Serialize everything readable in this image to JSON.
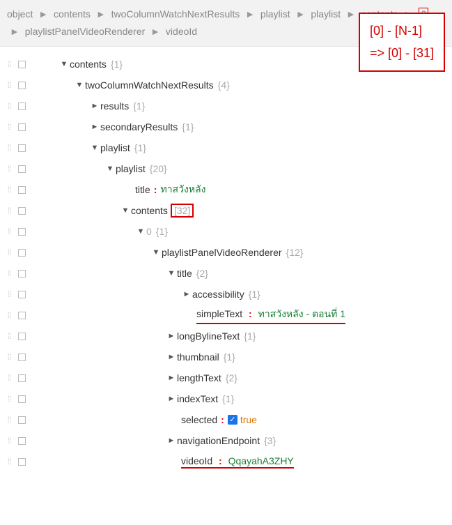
{
  "breadcrumb": {
    "items": [
      "object",
      "contents",
      "twoColumnWatchNextResults",
      "playlist",
      "playlist",
      "contents"
    ],
    "highlighted_index": "0",
    "items2": [
      "playlistPanelVideoRenderer",
      "videoId"
    ]
  },
  "annotation": {
    "line1": "[0] - [N-1]",
    "line2": "=> [0] - [31]"
  },
  "tree": {
    "contents": {
      "key": "contents",
      "count": "{1}"
    },
    "twoCol": {
      "key": "twoColumnWatchNextResults",
      "count": "{4}"
    },
    "results": {
      "key": "results",
      "count": "{1}"
    },
    "secondary": {
      "key": "secondaryResults",
      "count": "{1}"
    },
    "playlist1": {
      "key": "playlist",
      "count": "{1}"
    },
    "playlist2": {
      "key": "playlist",
      "count": "{20}"
    },
    "title1": {
      "key": "title",
      "val": "ทาสวังหลัง"
    },
    "contents2": {
      "key": "contents",
      "count": "[32]"
    },
    "idx0": {
      "key": "0",
      "count": "{1}"
    },
    "ppvr": {
      "key": "playlistPanelVideoRenderer",
      "count": "{12}"
    },
    "title2": {
      "key": "title",
      "count": "{2}"
    },
    "accessibility": {
      "key": "accessibility",
      "count": "{1}"
    },
    "simpleText": {
      "key": "simpleText",
      "val": "ทาสวังหลัง - ตอนที่ 1"
    },
    "longByline": {
      "key": "longBylineText",
      "count": "{1}"
    },
    "thumbnail": {
      "key": "thumbnail",
      "count": "{1}"
    },
    "lengthText": {
      "key": "lengthText",
      "count": "{2}"
    },
    "indexText": {
      "key": "indexText",
      "count": "{1}"
    },
    "selected": {
      "key": "selected",
      "val": "true"
    },
    "navEndpoint": {
      "key": "navigationEndpoint",
      "count": "{3}"
    },
    "videoId": {
      "key": "videoId",
      "val": "QqayahA3ZHY"
    }
  },
  "glyphs": {
    "down": "▼",
    "right": "►",
    "sep": "►",
    "check": "✓",
    "dots": "⁞⁞"
  }
}
